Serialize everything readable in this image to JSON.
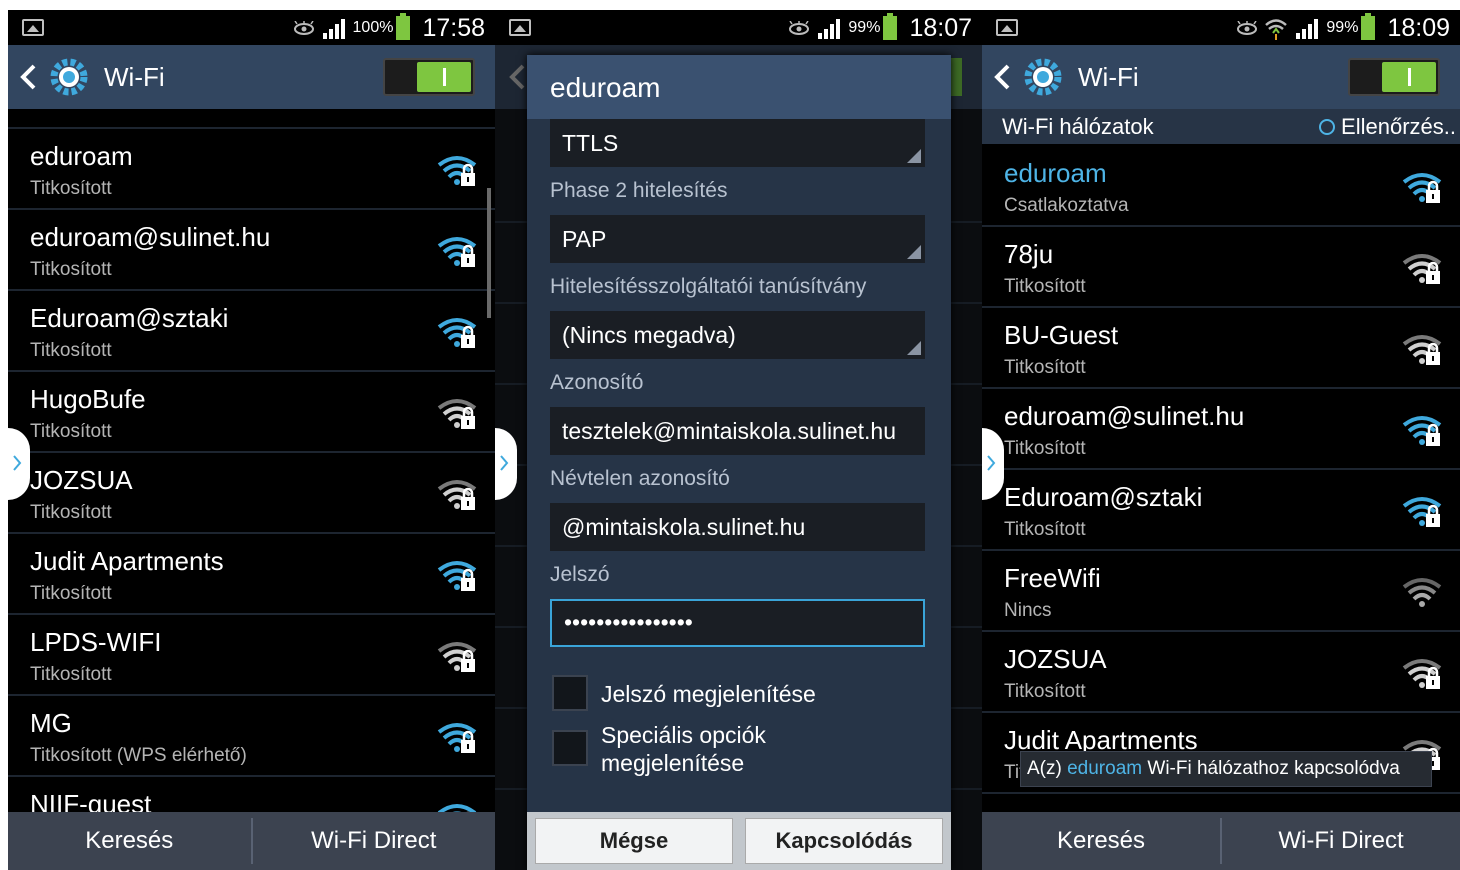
{
  "screens": [
    {
      "status": {
        "battery": "100%",
        "time": "17:58"
      },
      "actionbar": {
        "title": "Wi-Fi"
      },
      "list": [
        {
          "name": "eduroam",
          "sub": "Titkosított",
          "signal": "strong"
        },
        {
          "name": "eduroam@sulinet.hu",
          "sub": "Titkosított",
          "signal": "strong"
        },
        {
          "name": "Eduroam@sztaki",
          "sub": "Titkosított",
          "signal": "strong"
        },
        {
          "name": "HugoBufe",
          "sub": "Titkosított",
          "signal": "weak"
        },
        {
          "name": "JOZSUA",
          "sub": "Titkosított",
          "signal": "weak"
        },
        {
          "name": "Judit Apartments",
          "sub": "Titkosított",
          "signal": "strong"
        },
        {
          "name": "LPDS-WIFI",
          "sub": "Titkosított",
          "signal": "weak"
        },
        {
          "name": "MG",
          "sub": "Titkosított (WPS elérhető)",
          "signal": "strong"
        },
        {
          "name": "NIIF-guest",
          "sub": "",
          "signal": "strong"
        }
      ],
      "bottombar": {
        "left": "Keresés",
        "right": "Wi-Fi Direct"
      }
    },
    {
      "status": {
        "battery": "99%",
        "time": "18:07"
      },
      "dialog": {
        "title": "eduroam",
        "method_value": "TTLS",
        "phase2_label": "Phase 2 hitelesítés",
        "phase2_value": "PAP",
        "ca_label": "Hitelesítésszolgáltatói tanúsítvány",
        "ca_value": "(Nincs megadva)",
        "identity_label": "Azonosító",
        "identity_value": "tesztelek@mintaiskola.sulinet.hu",
        "anon_label": "Névtelen azonosító",
        "anon_value": "@mintaiskola.sulinet.hu",
        "password_label": "Jelszó",
        "password_value": "••••••••••••••••",
        "show_password_label": "Jelszó megjelenítése",
        "advanced_label_1": "Speciális opciók",
        "advanced_label_2": "megjelenítése",
        "cancel": "Mégse",
        "connect": "Kapcsolódás"
      }
    },
    {
      "status": {
        "battery": "99%",
        "time": "18:09"
      },
      "actionbar": {
        "title": "Wi-Fi"
      },
      "subheader": {
        "label": "Wi-Fi hálózatok",
        "scanning": "Ellenőrzés.."
      },
      "list": [
        {
          "name": "eduroam",
          "sub": "Csatlakoztatva",
          "signal": "strong",
          "connected": true
        },
        {
          "name": "78ju",
          "sub": "Titkosított",
          "signal": "weak"
        },
        {
          "name": "BU-Guest",
          "sub": "Titkosított",
          "signal": "weak"
        },
        {
          "name": "eduroam@sulinet.hu",
          "sub": "Titkosított",
          "signal": "strong"
        },
        {
          "name": "Eduroam@sztaki",
          "sub": "Titkosított",
          "signal": "strong"
        },
        {
          "name": "FreeWifi",
          "sub": "Nincs",
          "signal": "open"
        },
        {
          "name": "JOZSUA",
          "sub": "Titkosított",
          "signal": "weak"
        },
        {
          "name": "Judit Apartments",
          "sub": "Titkosított",
          "signal": "weak"
        }
      ],
      "toast": {
        "prefix": "A(z) ",
        "network": "eduroam",
        "suffix": " Wi-Fi hálózathoz kapcsolódva"
      },
      "bottombar": {
        "left": "Keresés",
        "right": "Wi-Fi Direct"
      }
    }
  ],
  "colors": {
    "accent": "#4eb4e6",
    "toggle_on": "#7ec640",
    "actionbar": "#324660"
  }
}
